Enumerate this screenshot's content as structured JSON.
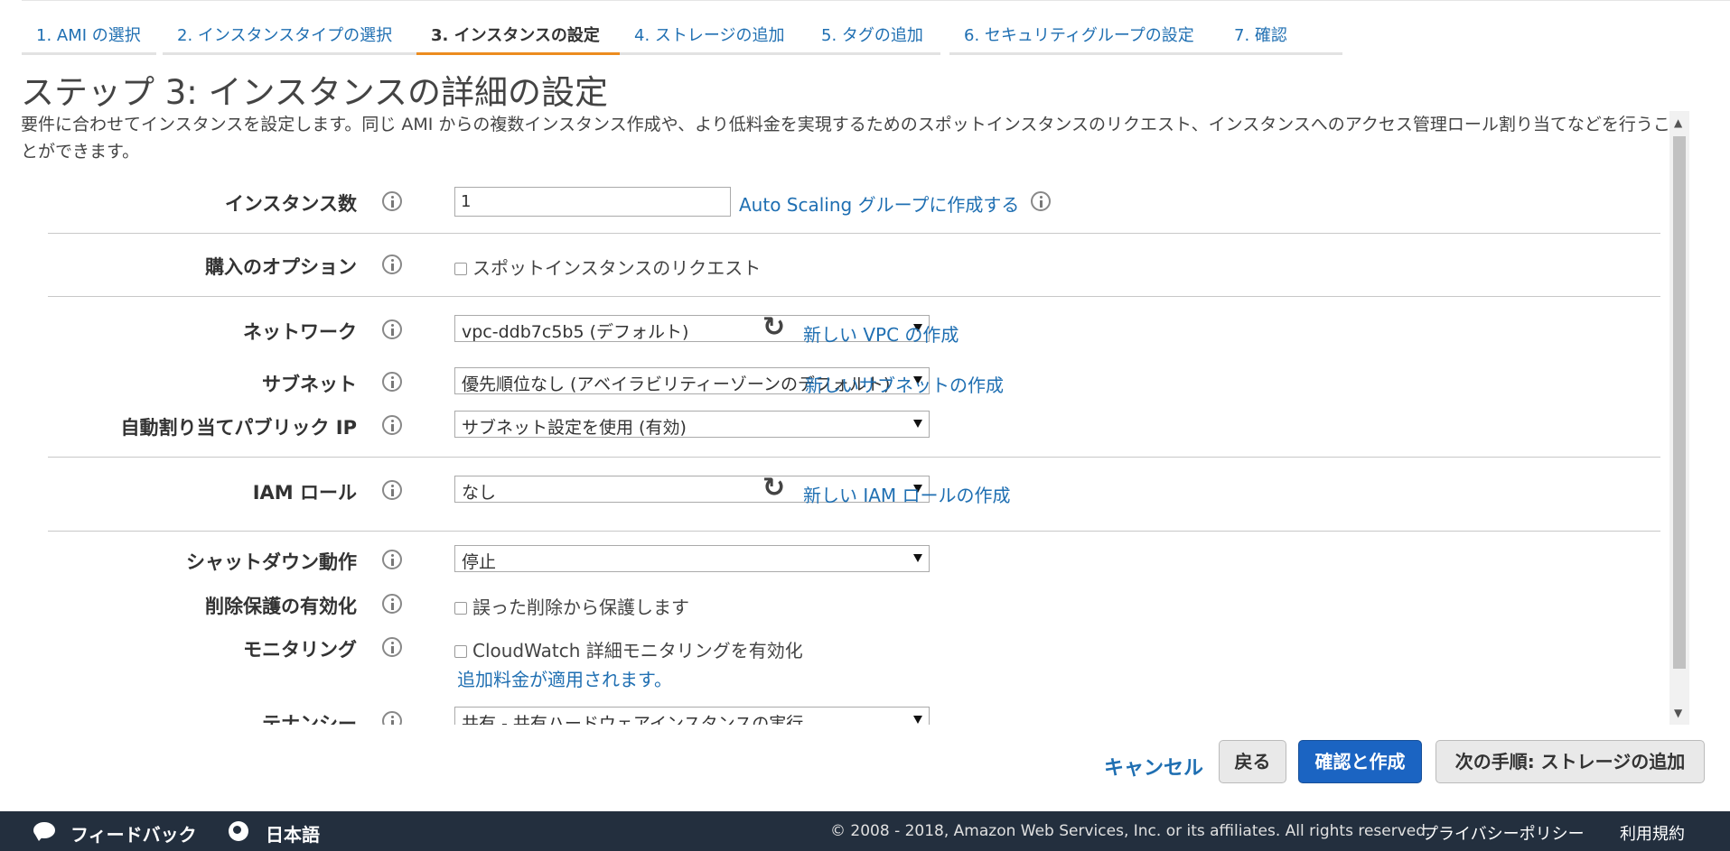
{
  "wizard": {
    "tabs": [
      {
        "label": "1. AMI の選択"
      },
      {
        "label": "2. インスタンスタイプの選択"
      },
      {
        "label": "3. インスタンスの設定"
      },
      {
        "label": "4. ストレージの追加"
      },
      {
        "label": "5. タグの追加"
      },
      {
        "label": "6. セキュリティグループの設定"
      },
      {
        "label": "7. 確認"
      }
    ],
    "active_tab_index": 2
  },
  "page": {
    "title": "ステップ 3: インスタンスの詳細の設定",
    "description": "要件に合わせてインスタンスを設定します。同じ AMI からの複数インスタンス作成や、より低料金を実現するためのスポットインスタンスのリクエスト、インスタンスへのアクセス管理ロール割り当てなどを行うことができます。"
  },
  "form": {
    "instance_count": {
      "label": "インスタンス数",
      "value": "1",
      "link": "Auto Scaling グループに作成する"
    },
    "purchase_option": {
      "label": "購入のオプション",
      "checkbox_label": "スポットインスタンスのリクエスト",
      "checked": false
    },
    "network": {
      "label": "ネットワーク",
      "value": "vpc-ddb7c5b5 (デフォルト)",
      "link": "新しい VPC の作成"
    },
    "subnet": {
      "label": "サブネット",
      "value": "優先順位なし (アベイラビリティーゾーンのデフォルト)",
      "link": "新しいサブネットの作成"
    },
    "public_ip": {
      "label": "自動割り当てパブリック IP",
      "value": "サブネット設定を使用 (有効)"
    },
    "iam_role": {
      "label": "IAM ロール",
      "value": "なし",
      "link": "新しい IAM ロールの作成"
    },
    "shutdown": {
      "label": "シャットダウン動作",
      "value": "停止"
    },
    "termination_protection": {
      "label": "削除保護の有効化",
      "checkbox_label": "誤った削除から保護します",
      "checked": false
    },
    "monitoring": {
      "label": "モニタリング",
      "checkbox_label": "CloudWatch 詳細モニタリングを有効化",
      "checked": false,
      "note_link": "追加料金が適用されます。"
    },
    "tenancy": {
      "label": "テナンシー",
      "value": "共有 - 共有ハードウェアインスタンスの実行"
    }
  },
  "actions": {
    "cancel": "キャンセル",
    "back": "戻る",
    "review": "確認と作成",
    "next": "次の手順: ストレージの追加"
  },
  "footer": {
    "feedback": "フィードバック",
    "language": "日本語",
    "copyright": "© 2008 - 2018, Amazon Web Services, Inc. or its affiliates. All rights reserved.",
    "privacy": "プライバシーポリシー",
    "terms": "利用規約"
  },
  "colors": {
    "accent_active_tab": "#ec8c1f",
    "link": "#1f6fb2",
    "primary_button": "#1b64c2",
    "footer_bar": "#232f3e"
  }
}
